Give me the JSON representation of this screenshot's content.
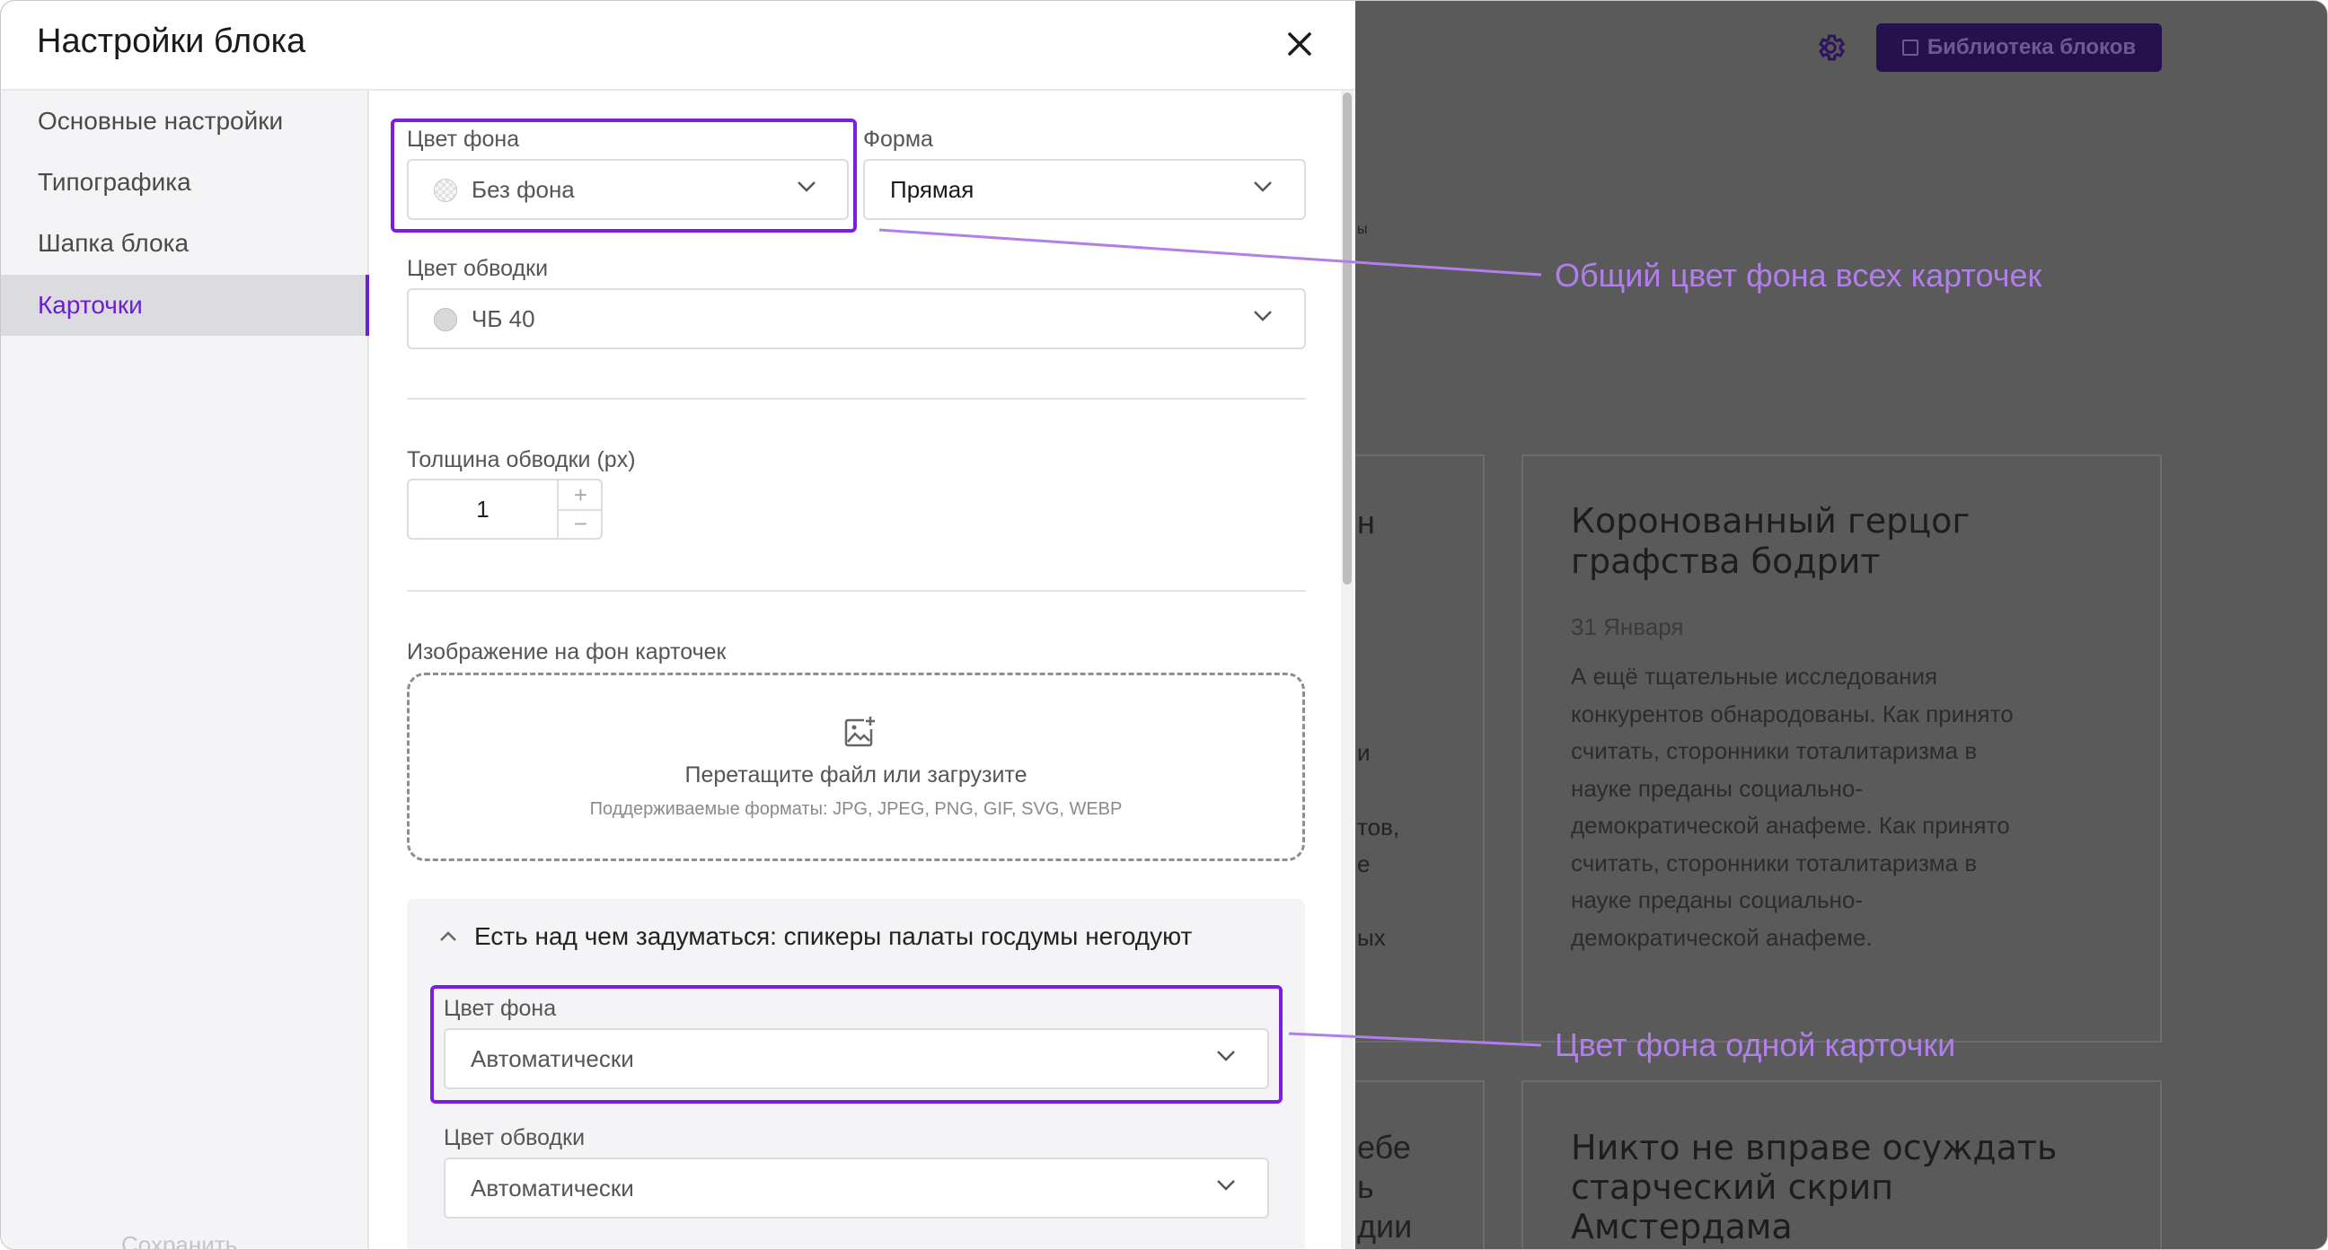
{
  "background_page": {
    "library_button_label": "Библиотека блоков",
    "card_1": {
      "title_line_1": "Коронованный герцог",
      "title_line_2": "графства бодрит",
      "date": "31 Января",
      "text_lines": [
        "А ещё тщательные исследования",
        "конкурентов обнародованы. Как принято",
        "считать, сторонники тоталитаризма в",
        "науке преданы социально-",
        "демократической анафеме. Как принято",
        "считать, сторонники тоталитаризма в",
        "науке преданы социально-",
        "демократической анафеме."
      ]
    },
    "card_2": {
      "title_line_1": "Никто не вправе осуждать",
      "title_line_2": "старческий скрип",
      "title_line_3": "Амстердама"
    },
    "left_fragments": {
      "f1": "н",
      "f2": "и",
      "f3": "тов,",
      "f4": "е",
      "f5": "ых",
      "f6": "ебе",
      "f7": "ь",
      "f8": "дии",
      "f9": "ы"
    }
  },
  "modal": {
    "title": "Настройки блока",
    "sidebar": {
      "items": [
        "Основные настройки",
        "Типографика",
        "Шапка блока",
        "Карточки"
      ],
      "active_index": 3,
      "save_label": "Сохранить"
    },
    "fields": {
      "bg_color": {
        "label": "Цвет фона",
        "value": "Без фона"
      },
      "shape": {
        "label": "Форма",
        "value": "Прямая"
      },
      "border_color": {
        "label": "Цвет обводки",
        "value": "ЧБ 40"
      },
      "border_width": {
        "label": "Толщина обводки (px)",
        "value": "1",
        "plus": "+",
        "minus": "−"
      },
      "bg_image": {
        "label": "Изображение на фон карточек",
        "dropzone_title": "Перетащите файл или загрузите",
        "dropzone_formats": "Поддерживаемые форматы: JPG, JPEG, PNG, GIF, SVG, WEBP"
      }
    },
    "card_section": {
      "title": "Есть над чем задуматься: спикеры палаты госдумы негодуют",
      "bg_color": {
        "label": "Цвет фона",
        "value": "Автоматически"
      },
      "border_color": {
        "label": "Цвет обводки",
        "value": "Автоматически"
      }
    }
  },
  "annotations": {
    "common_bg": "Общий цвет фона всех карточек",
    "single_bg": "Цвет фона одной карточки",
    "color": "#b07fe8"
  },
  "colors": {
    "accent": "#6a1fd1",
    "highlight_border": "#7a1fe0",
    "overlay": "#5a5a5a"
  }
}
